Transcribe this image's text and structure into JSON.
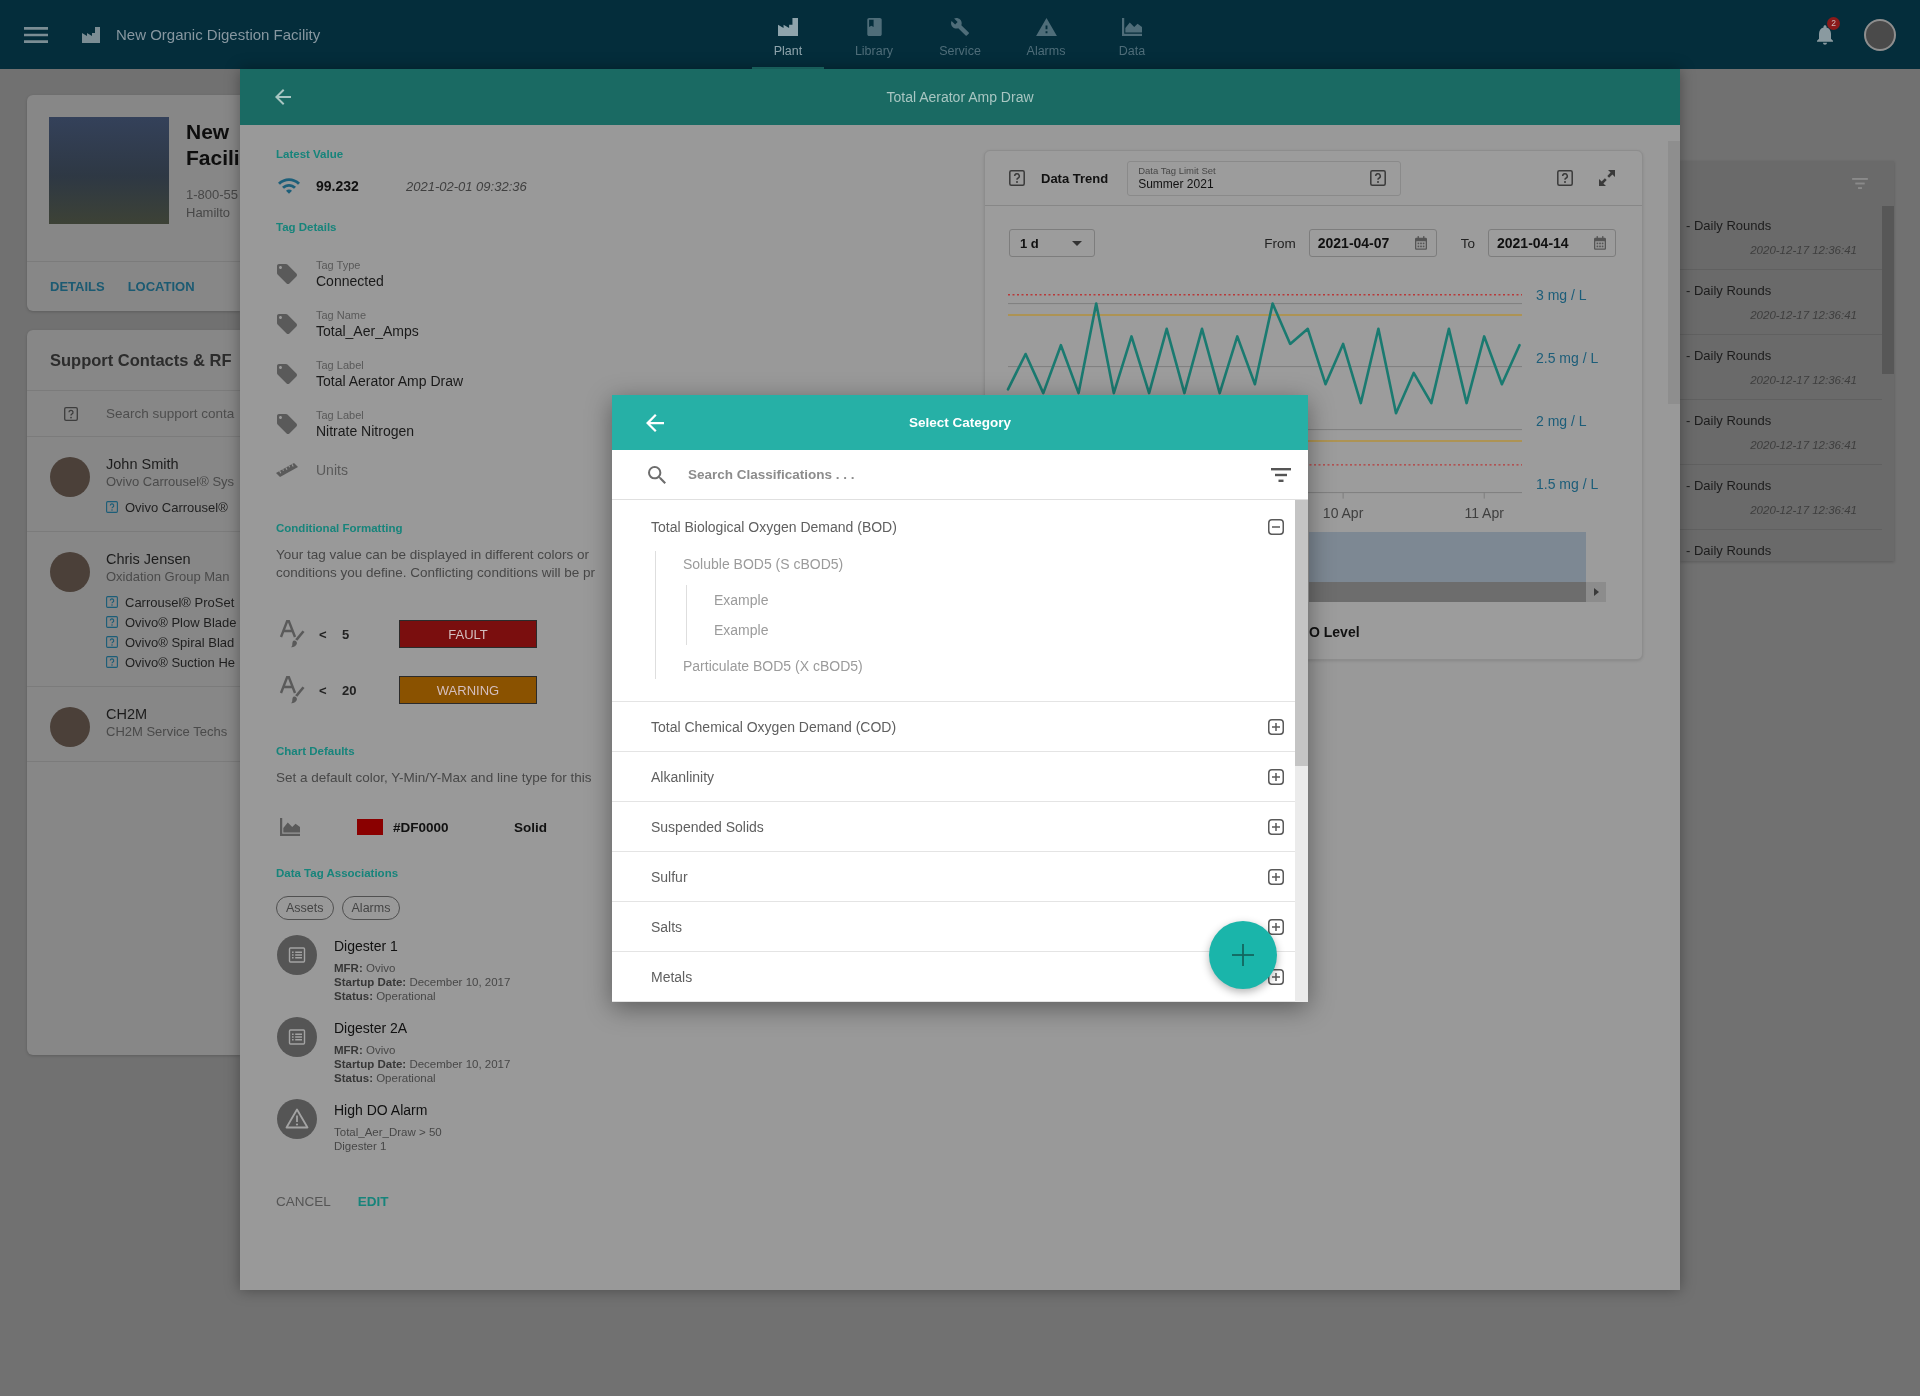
{
  "app_bar": {
    "title": "New Organic Digestion Facility",
    "nav": [
      {
        "label": "Plant",
        "selected": true
      },
      {
        "label": "Library",
        "selected": false
      },
      {
        "label": "Service",
        "selected": false
      },
      {
        "label": "Alarms",
        "selected": false
      },
      {
        "label": "Data",
        "selected": false
      }
    ],
    "notification_count": "2"
  },
  "facility_card": {
    "name": "New Facili",
    "phone": "1-800-55",
    "address": "Hamilto",
    "links": [
      "DETAILS",
      "LOCATION"
    ]
  },
  "support_contacts": {
    "title": "Support Contacts & RF",
    "search": {
      "placeholder": "Search support conta"
    },
    "contacts": [
      {
        "name": "John Smith",
        "role": "Ovivo Carrousel® Sys",
        "links": [
          "Ovivo Carrousel®"
        ]
      },
      {
        "name": "Chris Jensen",
        "role": "Oxidation Group Man",
        "links": [
          "Carrousel® ProSet",
          "Ovivo® Plow Blade",
          "Ovivo® Spiral Blad",
          "Ovivo® Suction He"
        ]
      },
      {
        "name": "CH2M",
        "role": "CH2M Service Techs"
      }
    ]
  },
  "rounds_list": {
    "items": [
      {
        "title": "- Daily Rounds",
        "time": "2020-12-17 12:36:41"
      },
      {
        "title": "- Daily Rounds",
        "time": "2020-12-17 12:36:41"
      },
      {
        "title": "- Daily Rounds",
        "time": "2020-12-17 12:36:41"
      },
      {
        "title": "- Daily Rounds",
        "time": "2020-12-17 12:36:41"
      },
      {
        "title": "- Daily Rounds",
        "time": "2020-12-17 12:36:41"
      },
      {
        "title": "- Daily Rounds"
      }
    ]
  },
  "tag_panel": {
    "title": "Total Aerator Amp Draw",
    "latest_value": {
      "heading": "Latest Value",
      "value": "99.232",
      "timestamp": "2021-02-01 09:32:36"
    },
    "tag_details": {
      "heading": "Tag Details",
      "fields": [
        {
          "kind": "tag",
          "label": "Tag Type",
          "value": "Connected"
        },
        {
          "kind": "tag",
          "label": "Tag Name",
          "value": "Total_Aer_Amps"
        },
        {
          "kind": "tag",
          "label": "Tag Label",
          "value": "Total Aerator Amp Draw"
        },
        {
          "kind": "tag",
          "label": "Tag Label",
          "value": "Nitrate Nitrogen"
        },
        {
          "kind": "units",
          "label": "Units"
        }
      ]
    },
    "conditional_formatting": {
      "heading": "Conditional Formatting",
      "description": "Your tag value can be displayed in different colors or\nconditions you define. Conflicting conditions will be pr",
      "rules": [
        {
          "operator": "<",
          "threshold": "5",
          "label": "FAULT",
          "color": "#7a0e0e"
        },
        {
          "operator": "<",
          "threshold": "20",
          "label": "WARNING",
          "color": "#8a5200"
        }
      ]
    },
    "chart_defaults": {
      "heading": "Chart Defaults",
      "description": "Set a default color, Y-Min/Y-Max and line type for this",
      "color_value": "#DF0000",
      "line_type": "Solid"
    },
    "associations": {
      "heading": "Data Tag Associations",
      "filters": [
        "Assets",
        "Alarms"
      ],
      "items": [
        {
          "kind": "asset",
          "title": "Digester 1",
          "lines": [
            "**MFR:** Ovivo",
            "**Startup Date:** December 10, 2017",
            "**Status:** Operational"
          ]
        },
        {
          "kind": "asset",
          "title": "Digester 2A",
          "lines": [
            "**MFR:** Ovivo",
            "**Startup Date:** December 10, 2017",
            "**Status:** Operational"
          ]
        },
        {
          "kind": "alarm",
          "title": "High DO Alarm",
          "lines": [
            "Total_Aer_Draw > 50",
            "Digester 1"
          ]
        }
      ]
    },
    "actions": [
      {
        "kind": "secondary",
        "label": "CANCEL"
      },
      {
        "kind": "primary",
        "label": "EDIT"
      }
    ],
    "data_trend": {
      "title": "Data Trend",
      "limit_set": {
        "label": "Data Tag Limit Set",
        "value": "Summer 2021"
      },
      "period": "1 d",
      "from": {
        "label": "From",
        "value": "2021-04-07"
      },
      "to": {
        "label": "To",
        "value": "2021-04-14"
      },
      "chart_data": {
        "type": "line",
        "grid": true,
        "categories": [
          null,
          null,
          null,
          null,
          null,
          null,
          null,
          null,
          null,
          null,
          null,
          null,
          null,
          null,
          null,
          null,
          null,
          null,
          null,
          "10 Apr",
          null,
          null,
          null,
          null,
          null,
          null,
          null,
          "11 Apr",
          null,
          null
        ],
        "series": [
          {
            "name": "O Level",
            "color": "#1a7a70",
            "values": [
              2.32,
              2.6,
              2.29,
              2.67,
              2.29,
              3.0,
              2.29,
              2.74,
              2.29,
              2.8,
              2.29,
              2.8,
              2.29,
              2.74,
              2.36,
              3.0,
              2.68,
              2.8,
              2.36,
              2.68,
              2.21,
              2.8,
              2.13,
              2.45,
              2.21,
              2.8,
              2.21,
              2.74,
              2.36,
              2.67
            ]
          }
        ],
        "ylim": [
          1.5,
          3
        ],
        "yticks": [
          {
            "value": 1.5,
            "label": "1.5 mg / L"
          },
          {
            "value": 2,
            "label": "2 mg / L"
          },
          {
            "value": 2.5,
            "label": "2.5 mg / L"
          },
          {
            "value": 3,
            "label": "3 mg / L"
          }
        ],
        "ref_lines": [
          {
            "axis": "y",
            "value": 3.07,
            "color": "#b83a3a"
          },
          {
            "axis": "y",
            "value": 2.91,
            "color": "#b3913d"
          },
          {
            "axis": "y",
            "value": 1.91,
            "color": "#b3913d"
          },
          {
            "axis": "y",
            "value": 1.72,
            "color": "#b83a3a"
          }
        ]
      }
    }
  },
  "category_dialog": {
    "title": "Select Category",
    "search": {
      "placeholder": "Search Classifications . . ."
    },
    "categories": [
      {
        "label": "Total Biological Oxygen Demand (BOD)",
        "expanded": true,
        "children": [
          {
            "label": "Soluble BOD5 (S cBOD5)",
            "children": [
              {
                "label": "Example"
              },
              {
                "label": "Example"
              }
            ]
          },
          {
            "label": "Particulate BOD5 (X cBOD5)"
          }
        ]
      },
      {
        "label": "Total Chemical Oxygen Demand (COD)",
        "expanded": false
      },
      {
        "label": "Alkanlinity",
        "expanded": false
      },
      {
        "label": "Suspended Solids",
        "expanded": false
      },
      {
        "label": "Sulfur",
        "expanded": false
      },
      {
        "label": "Salts",
        "expanded": false
      },
      {
        "label": "Metals",
        "expanded": false
      }
    ]
  }
}
